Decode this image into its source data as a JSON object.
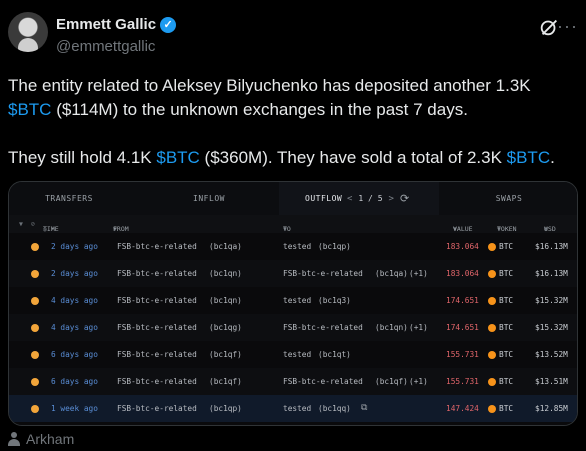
{
  "author": {
    "name": "Emmett Gallic",
    "handle": "@emmettgallic"
  },
  "tweet": {
    "line1_a": "The entity related to Aleksey Bilyuchenko has deposited another 1.3K",
    "line1_cashtag": "$BTC",
    "line1_b": " ($114M)  to the unknown exchanges in the past 7 days.",
    "line2_a": "They still hold 4.1K ",
    "line2_cashtag1": "$BTC",
    "line2_b": " ($360M). They have sold a total of 2.3K ",
    "line2_cashtag2": "$BTC",
    "line2_c": "."
  },
  "card": {
    "tabs": {
      "transfers": "TRANSFERS",
      "inflow": "INFLOW",
      "outflow": "OUTFLOW",
      "swaps": "SWAPS"
    },
    "pager": {
      "prev": "<",
      "page": "1 / 5",
      "next": ">"
    },
    "columns": {
      "time": "TIME",
      "from": "FROM",
      "to": "TO",
      "value": "VALUE",
      "token": "TOKEN",
      "usd": "USD"
    },
    "rows": [
      {
        "time": "2 days ago",
        "from_entity": "FSB-btc-e-related",
        "from_addr": "(bc1qa)",
        "to_entity": "tested",
        "to_addr": "(bc1qp)",
        "to_extra": "",
        "value": "183.064",
        "token": "BTC",
        "usd": "$16.13M"
      },
      {
        "time": "2 days ago",
        "from_entity": "FSB-btc-e-related",
        "from_addr": "(bc1qn)",
        "to_entity": "FSB-btc-e-related",
        "to_addr": "(bc1qa)",
        "to_extra": "(+1)",
        "value": "183.064",
        "token": "BTC",
        "usd": "$16.13M"
      },
      {
        "time": "4 days ago",
        "from_entity": "FSB-btc-e-related",
        "from_addr": "(bc1qn)",
        "to_entity": "tested",
        "to_addr": "(bc1q3)",
        "to_extra": "",
        "value": "174.651",
        "token": "BTC",
        "usd": "$15.32M"
      },
      {
        "time": "4 days ago",
        "from_entity": "FSB-btc-e-related",
        "from_addr": "(bc1qg)",
        "to_entity": "FSB-btc-e-related",
        "to_addr": "(bc1qn)",
        "to_extra": "(+1)",
        "value": "174.651",
        "token": "BTC",
        "usd": "$15.32M"
      },
      {
        "time": "6 days ago",
        "from_entity": "FSB-btc-e-related",
        "from_addr": "(bc1qf)",
        "to_entity": "tested",
        "to_addr": "(bc1qt)",
        "to_extra": "",
        "value": "155.731",
        "token": "BTC",
        "usd": "$13.52M"
      },
      {
        "time": "6 days ago",
        "from_entity": "FSB-btc-e-related",
        "from_addr": "(bc1qf)",
        "to_entity": "FSB-btc-e-related",
        "to_addr": "(bc1qf)",
        "to_extra": "(+1)",
        "value": "155.731",
        "token": "BTC",
        "usd": "$13.51M"
      },
      {
        "time": "1 week ago",
        "from_entity": "FSB-btc-e-related",
        "from_addr": "(bc1qp)",
        "to_entity": "tested",
        "to_addr": "(bc1qq)",
        "to_extra": "",
        "value": "147.424",
        "token": "BTC",
        "usd": "$12.85M"
      }
    ]
  },
  "source": {
    "label": "Arkham"
  }
}
